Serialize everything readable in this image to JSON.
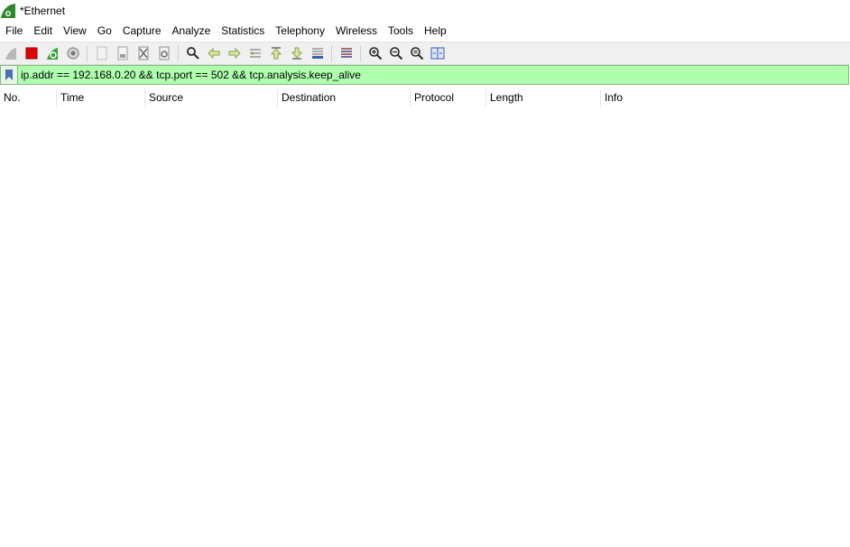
{
  "window": {
    "title": "*Ethernet"
  },
  "menu": [
    "File",
    "Edit",
    "View",
    "Go",
    "Capture",
    "Analyze",
    "Statistics",
    "Telephony",
    "Wireless",
    "Tools",
    "Help"
  ],
  "toolbar": {
    "icons": [
      "shark-fin-start-icon",
      "stop-capture-icon",
      "restart-capture-icon",
      "capture-options-icon",
      "open-file-icon",
      "save-file-icon",
      "close-file-icon",
      "reload-file-icon",
      "find-packet-icon",
      "go-back-icon",
      "go-forward-icon",
      "go-to-packet-icon",
      "first-packet-icon",
      "last-packet-icon",
      "auto-scroll-icon",
      "colorize-icon",
      "zoom-in-icon",
      "zoom-out-icon",
      "normal-size-icon",
      "resize-columns-icon"
    ],
    "colors": {
      "stop": "#e00000",
      "green": "#3aa03a",
      "zoomglass": "#2a2a2a"
    }
  },
  "filter": {
    "value": "ip.addr == 192.168.0.20 && tcp.port == 502 && tcp.analysis.keep_alive",
    "background": "#afffaf"
  },
  "columns": [
    "No.",
    "Time",
    "Source",
    "Destination",
    "Protocol",
    "Length",
    "Info"
  ],
  "packets": []
}
